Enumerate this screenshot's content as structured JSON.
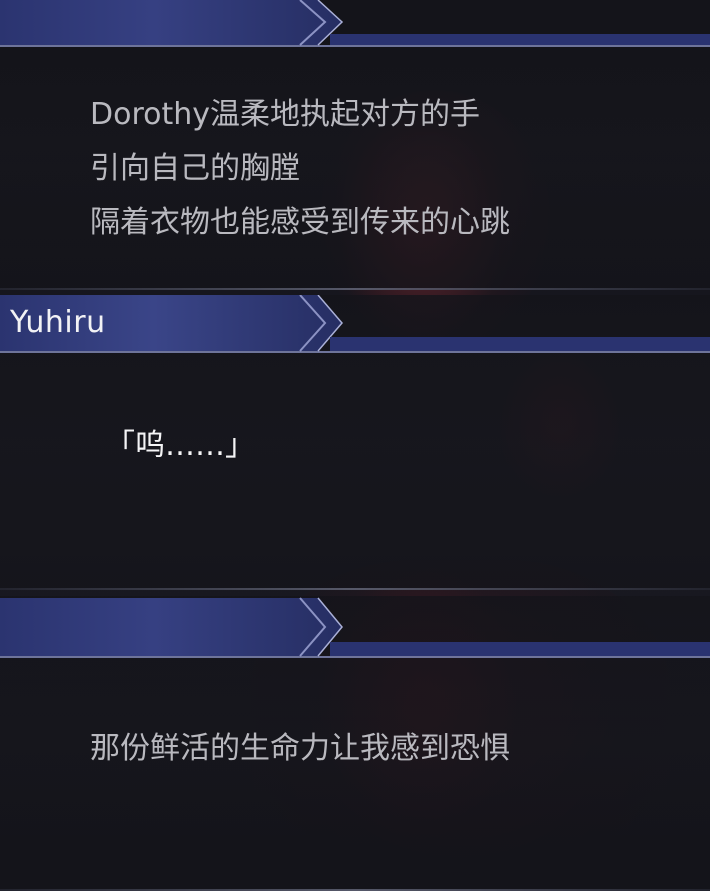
{
  "colors": {
    "nameplate_blue": "#2a3370",
    "nameplate_edge": "#8c93c4",
    "narration_text": "#b9b9bf",
    "speech_text": "#f4f4f6"
  },
  "dialog_boxes": [
    {
      "speaker": "",
      "lines": [
        "Dorothy温柔地执起对方的手",
        "引向自己的胸膛",
        "隔着衣物也能感受到传来的心跳"
      ]
    },
    {
      "speaker": "Yuhiru",
      "lines": [
        "「呜……」"
      ]
    },
    {
      "speaker": "",
      "lines": [
        "那份鲜活的生命力让我感到恐惧"
      ]
    }
  ]
}
